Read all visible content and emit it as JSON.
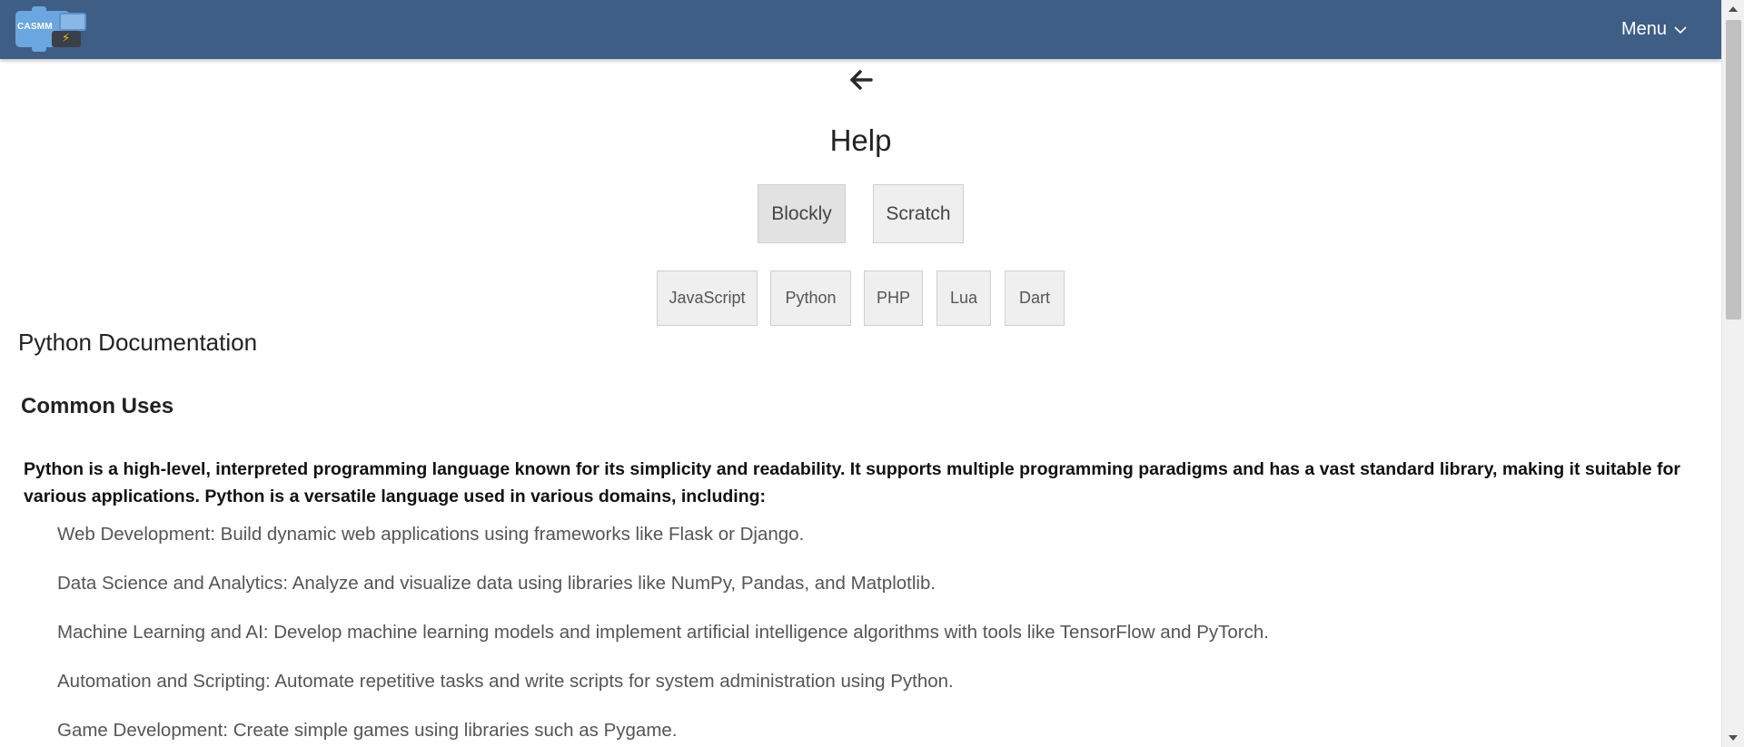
{
  "header": {
    "logo_text": "CASMM",
    "menu_label": "Menu"
  },
  "page": {
    "title": "Help"
  },
  "editor_buttons": [
    {
      "label": "Blockly",
      "active": true
    },
    {
      "label": "Scratch",
      "active": false
    }
  ],
  "language_buttons": [
    {
      "label": "JavaScript"
    },
    {
      "label": "Python"
    },
    {
      "label": "PHP"
    },
    {
      "label": "Lua"
    },
    {
      "label": "Dart"
    }
  ],
  "doc": {
    "title": "Python Documentation",
    "section_title": "Common Uses",
    "intro": "Python is a high-level, interpreted programming language known for its simplicity and readability. It supports multiple programming paradigms and has a vast standard library, making it suitable for various applications. Python is a versatile language used in various domains, including:",
    "uses": [
      "Web Development: Build dynamic web applications using frameworks like Flask or Django.",
      "Data Science and Analytics: Analyze and visualize data using libraries like NumPy, Pandas, and Matplotlib.",
      "Machine Learning and AI: Develop machine learning models and implement artificial intelligence algorithms with tools like TensorFlow and PyTorch.",
      "Automation and Scripting: Automate repetitive tasks and write scripts for system administration using Python.",
      "Game Development: Create simple games using libraries such as Pygame."
    ]
  },
  "colors": {
    "navbar": "#3f5e85",
    "button_bg": "#efefef",
    "button_active_bg": "#e2e2e2"
  },
  "icons": {
    "back": "arrow-left-icon",
    "menu_chevron": "chevron-down-icon",
    "logo": "casmm-logo-icon"
  }
}
